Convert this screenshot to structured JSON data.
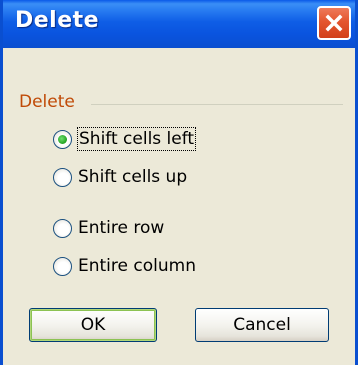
{
  "window": {
    "title": "Delete",
    "close_icon": "close-icon"
  },
  "group": {
    "label": "Delete",
    "options": [
      {
        "label": "Shift cells left",
        "checked": true
      },
      {
        "label": "Shift cells up",
        "checked": false
      },
      {
        "label": "Entire row",
        "checked": false
      },
      {
        "label": "Entire column",
        "checked": false
      }
    ]
  },
  "buttons": {
    "ok_label": "OK",
    "cancel_label": "Cancel"
  },
  "colors": {
    "titlebar": "#0a54df",
    "group_label": "#c04a06",
    "radio_checked": "#21a121",
    "dialog_bg": "#ece9d8"
  }
}
